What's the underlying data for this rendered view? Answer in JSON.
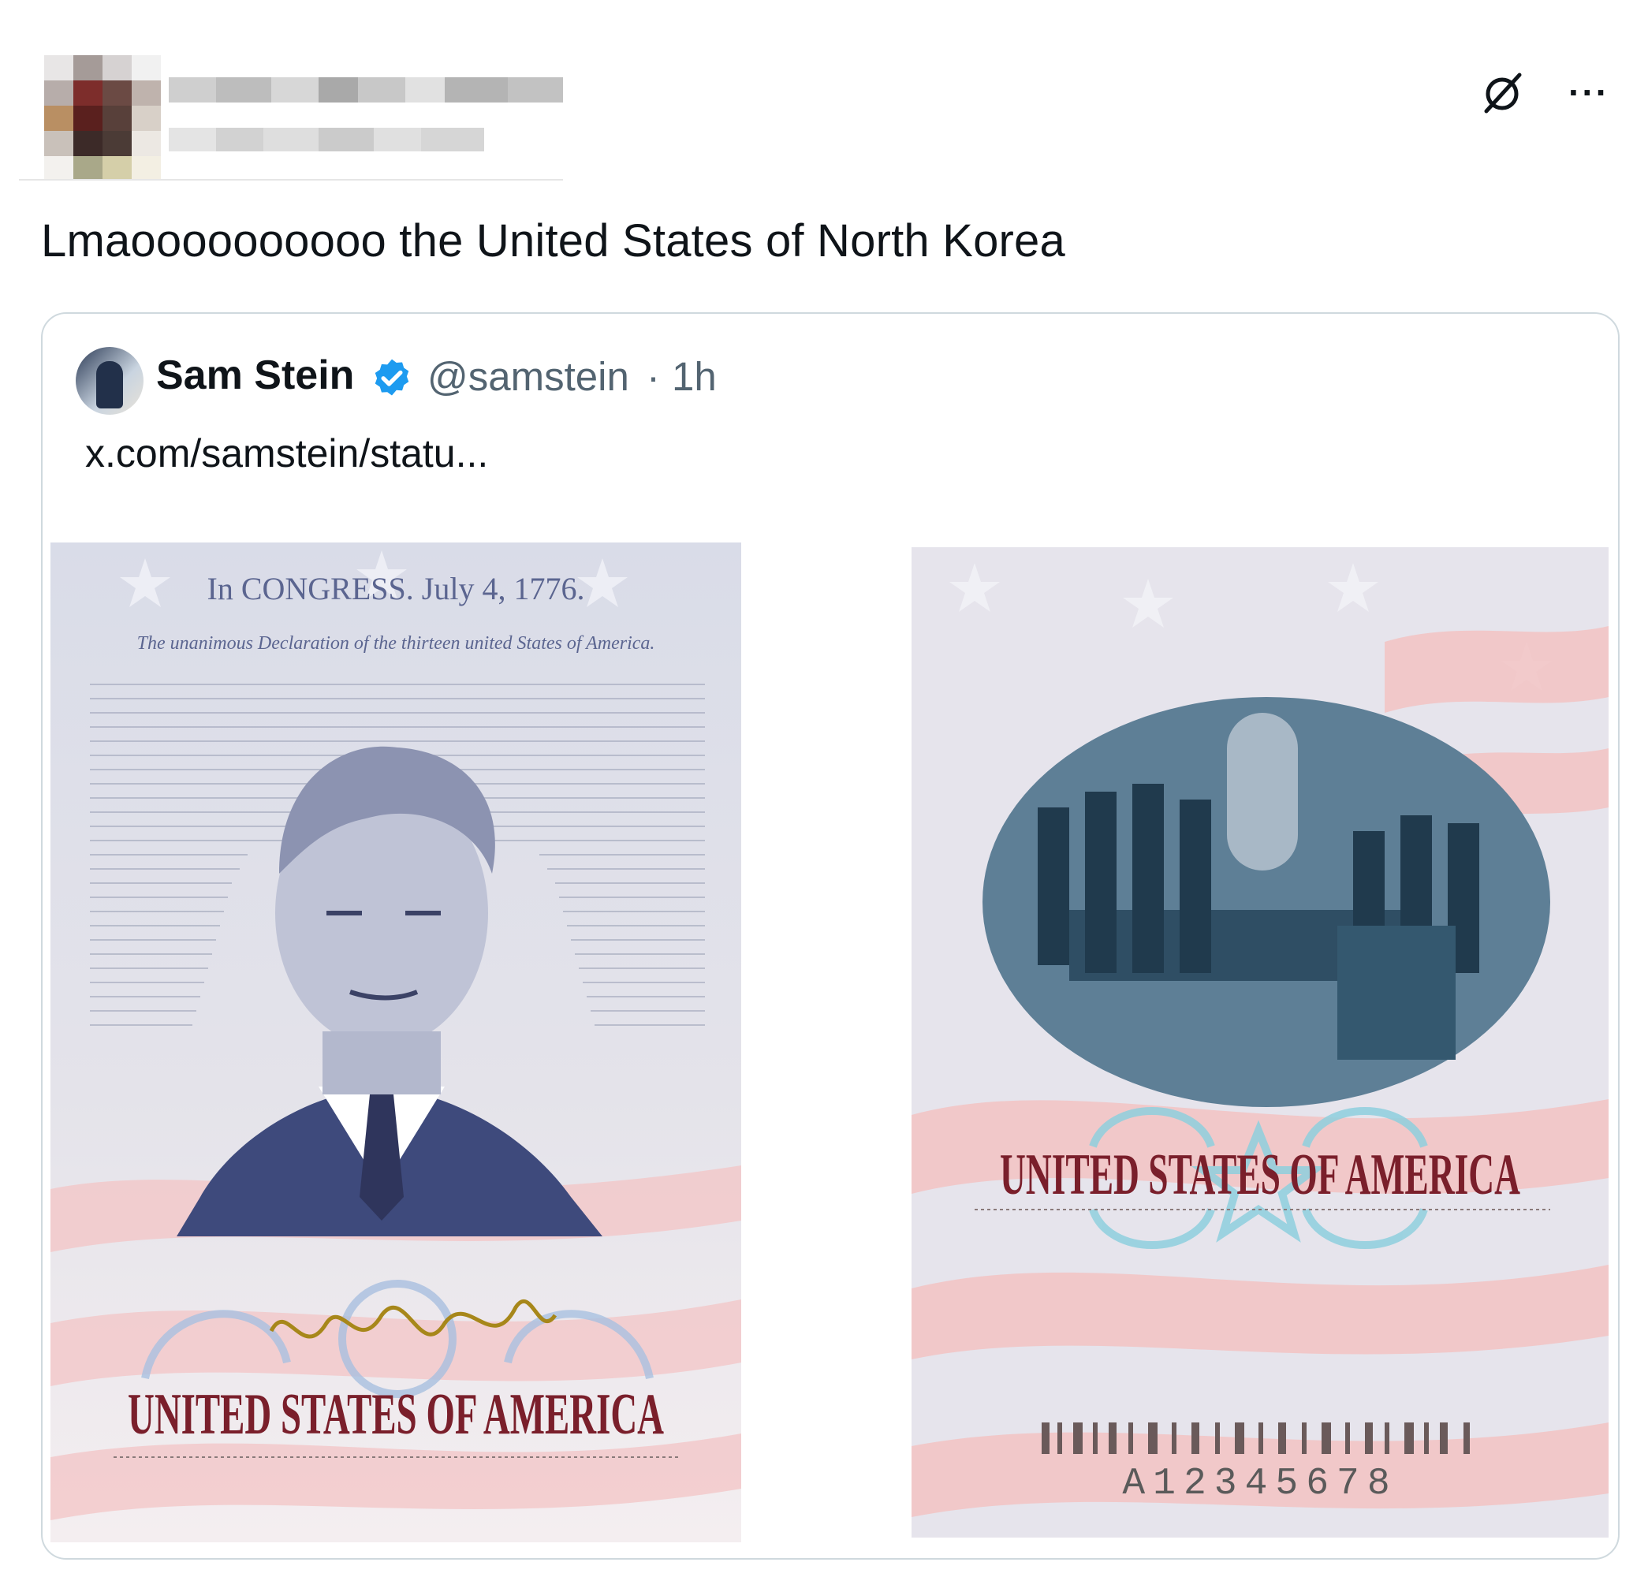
{
  "post": {
    "text": "Lmaoooooooooo the United States of North Korea",
    "icons": {
      "grok": "grok-slash-icon",
      "more": "more-dots-icon"
    },
    "more_label": "···"
  },
  "quoted": {
    "name": "Sam Stein",
    "verified": true,
    "handle": "@samstein",
    "separator": "·",
    "time": "1h",
    "link": "x.com/samstein/statu..."
  },
  "images": {
    "left": {
      "header": "In CONGRESS. July 4, 1776.",
      "subheader": "The unanimous Declaration of the thirteen united States of America.",
      "caption": "UNITED STATES OF AMERICA"
    },
    "right": {
      "caption": "UNITED STATES OF AMERICA",
      "serial": "A12345678"
    }
  },
  "colors": {
    "text": "#0f1419",
    "secondary": "#536471",
    "border": "#cfd9de",
    "verified": "#1d9bf0",
    "caption": "#7a1f2b"
  }
}
